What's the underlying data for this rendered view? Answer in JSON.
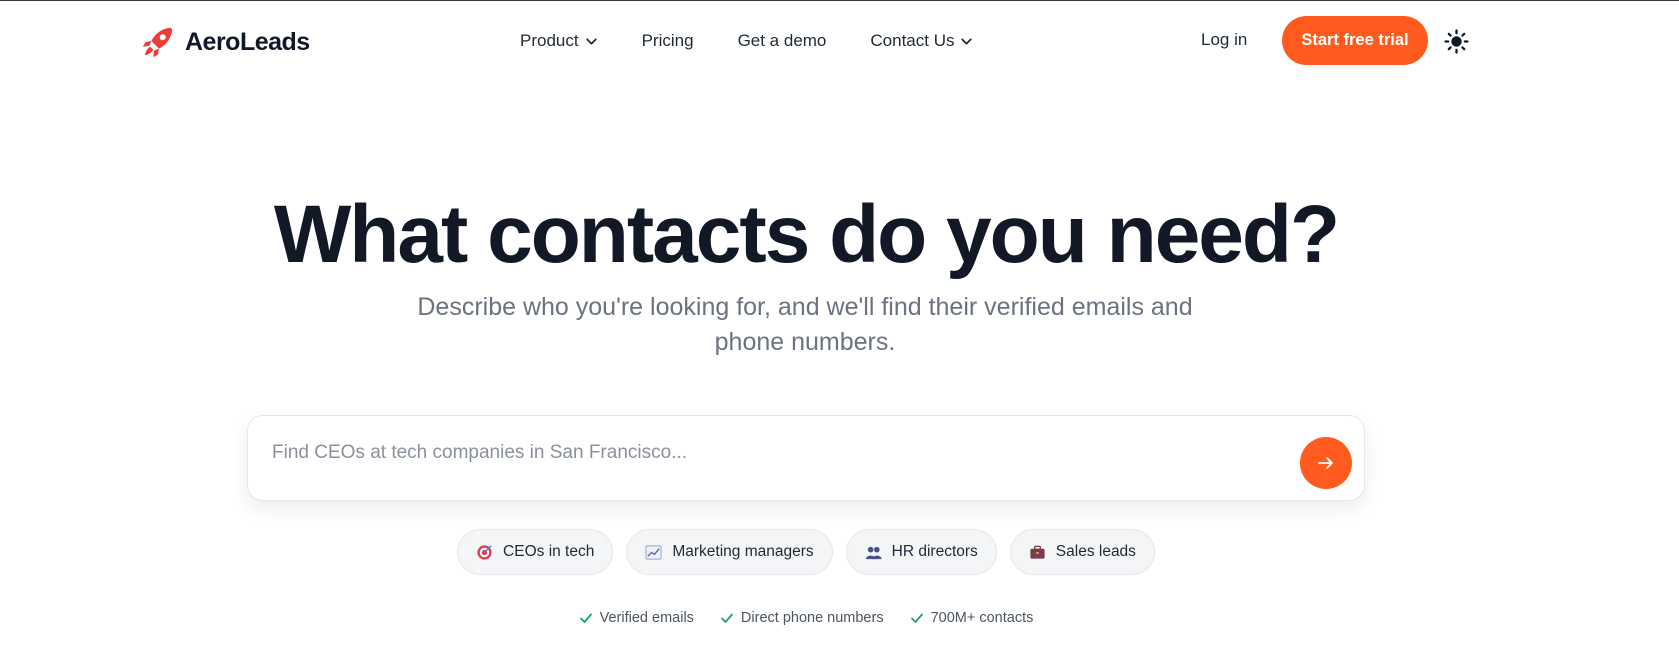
{
  "brand": {
    "name": "AeroLeads",
    "logo_icon": "rocket-icon",
    "accent": "#ff5b1f"
  },
  "nav": {
    "items": [
      {
        "label": "Product",
        "has_dropdown": true
      },
      {
        "label": "Pricing",
        "has_dropdown": false
      },
      {
        "label": "Get a demo",
        "has_dropdown": false
      },
      {
        "label": "Contact Us",
        "has_dropdown": true
      }
    ],
    "login_label": "Log in",
    "cta_label": "Start free trial",
    "theme_icon": "sun-icon"
  },
  "hero": {
    "title": "What contacts do you need?",
    "subtitle": "Describe who you're looking for, and we'll find their verified emails and phone numbers."
  },
  "search": {
    "placeholder": "Find CEOs at tech companies in San Francisco...",
    "value": "",
    "submit_icon": "arrow-right-icon"
  },
  "suggestions": [
    {
      "label": "CEOs in tech",
      "icon": "target-icon"
    },
    {
      "label": "Marketing managers",
      "icon": "chart-icon"
    },
    {
      "label": "HR directors",
      "icon": "people-icon"
    },
    {
      "label": "Sales leads",
      "icon": "briefcase-icon"
    }
  ],
  "features": [
    {
      "label": "Verified emails",
      "icon": "check-icon"
    },
    {
      "label": "Direct phone numbers",
      "icon": "check-icon"
    },
    {
      "label": "700M+ contacts",
      "icon": "check-icon"
    }
  ],
  "colors": {
    "check": "#22a06b",
    "text": "#111827",
    "muted": "#6b7280"
  }
}
